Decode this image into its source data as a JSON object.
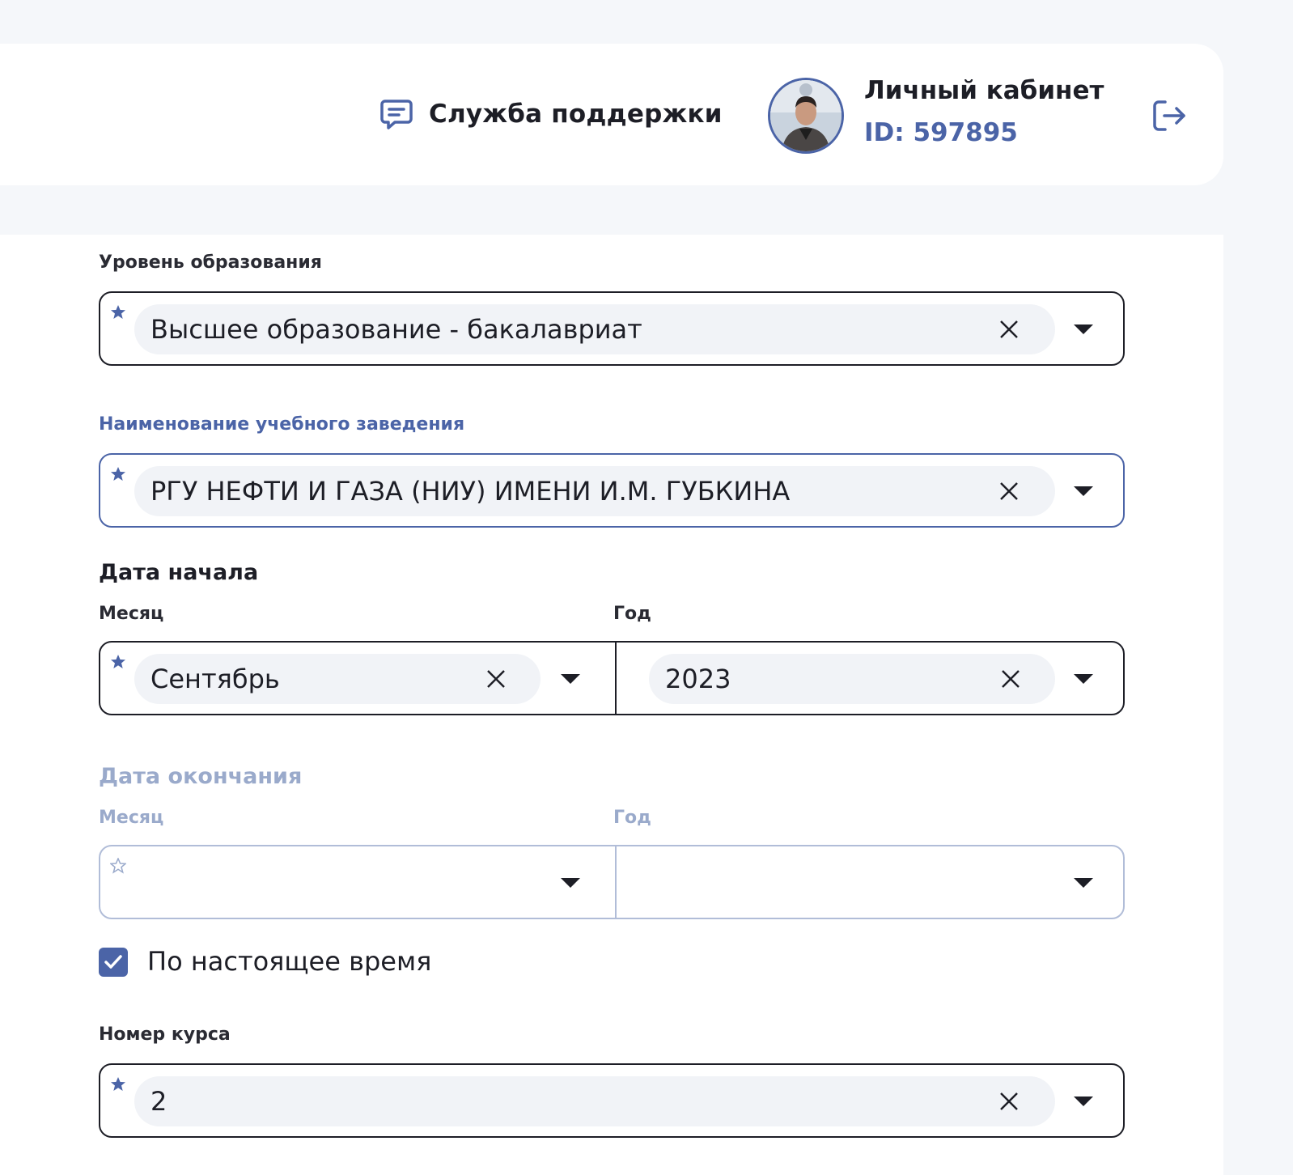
{
  "header": {
    "support_label": "Служба поддержки",
    "cabinet_title": "Личный кабинет",
    "user_id": "ID: 597895"
  },
  "form": {
    "education_level": {
      "label": "Уровень образования",
      "value": "Высшее образование - бакалавриат"
    },
    "institution": {
      "label": "Наименование учебного заведения",
      "value": "РГУ НЕФТИ И ГАЗА (НИУ) ИМЕНИ И.М. ГУБКИНА"
    },
    "start_date": {
      "title": "Дата начала",
      "month_label": "Месяц",
      "year_label": "Год",
      "month_value": "Сентябрь",
      "year_value": "2023"
    },
    "end_date": {
      "title": "Дата окончания",
      "month_label": "Месяц",
      "year_label": "Год",
      "month_value": "",
      "year_value": ""
    },
    "present_checkbox": {
      "label": "По настоящее время",
      "checked": true
    },
    "course_number": {
      "label": "Номер курса",
      "value": "2"
    }
  },
  "colors": {
    "accent": "#4b64a7",
    "border": "#1d1e26",
    "muted": "#9aaacb",
    "chip": "#f1f3f7",
    "background": "#f5f7fa"
  },
  "icons": {
    "support": "chat-icon",
    "logout": "logout-icon",
    "required": "star-icon",
    "clear": "close-icon",
    "dropdown": "caret-down-icon"
  }
}
